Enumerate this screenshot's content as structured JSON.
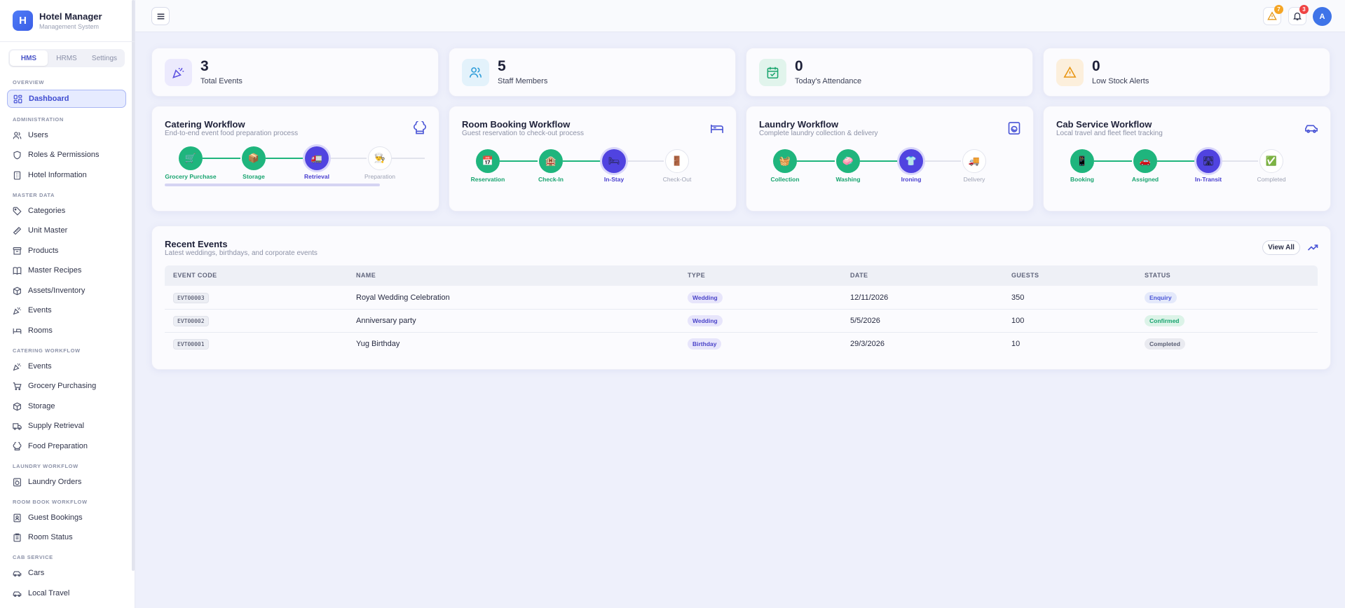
{
  "app": {
    "logo_letter": "H",
    "title": "Hotel Manager",
    "subtitle": "Management System"
  },
  "sidebar": {
    "tabs": [
      {
        "label": "HMS",
        "active": true
      },
      {
        "label": "HRMS",
        "active": false
      },
      {
        "label": "Settings",
        "active": false
      }
    ],
    "sections": {
      "overview": "OVERVIEW",
      "administration": "ADMINISTRATION",
      "master_data": "MASTER DATA",
      "catering": "CATERING WORKFLOW",
      "laundry": "LAUNDRY WORKFLOW",
      "room_book": "ROOM BOOK WORKFLOW",
      "cab": "CAB SERVICE"
    },
    "items": {
      "dashboard": "Dashboard",
      "users": "Users",
      "roles": "Roles & Permissions",
      "hotel_info": "Hotel Information",
      "categories": "Categories",
      "unit_master": "Unit Master",
      "products": "Products",
      "master_recipes": "Master Recipes",
      "assets": "Assets/Inventory",
      "events": "Events",
      "rooms": "Rooms",
      "catering_events": "Events",
      "grocery": "Grocery Purchasing",
      "storage": "Storage",
      "supply_retrieval": "Supply Retrieval",
      "food_prep": "Food Preparation",
      "laundry_orders": "Laundry Orders",
      "guest_bookings": "Guest Bookings",
      "room_status": "Room Status",
      "cars": "Cars",
      "local_travel": "Local Travel"
    }
  },
  "topbar": {
    "alerts_count": "7",
    "notifications_count": "3",
    "avatar_letter": "A",
    "colors": {
      "alert_badge": "#f5a524",
      "notif_badge": "#ef4444",
      "avatar": "#3f74e8"
    }
  },
  "stats": [
    {
      "value": "3",
      "label": "Total Events",
      "icon": "party-popper-icon"
    },
    {
      "value": "5",
      "label": "Staff Members",
      "icon": "users-icon"
    },
    {
      "value": "0",
      "label": "Today's Attendance",
      "icon": "calendar-check-icon"
    },
    {
      "value": "0",
      "label": "Low Stock Alerts",
      "icon": "warning-icon"
    }
  ],
  "workflows": {
    "catering": {
      "title": "Catering Workflow",
      "subtitle": "End-to-end event food preparation process",
      "icon": "chef-hat-icon",
      "steps": [
        {
          "label": "Grocery Purchase",
          "emoji": "🛒",
          "state": "done"
        },
        {
          "label": "Storage",
          "emoji": "📦",
          "state": "done"
        },
        {
          "label": "Retrieval",
          "emoji": "🚛",
          "state": "current"
        },
        {
          "label": "Preparation",
          "emoji": "👨‍🍳",
          "state": "todo"
        }
      ],
      "progress": 0.75
    },
    "room": {
      "title": "Room Booking Workflow",
      "subtitle": "Guest reservation to check-out process",
      "icon": "bed-icon",
      "steps": [
        {
          "label": "Reservation",
          "emoji": "📅",
          "state": "done"
        },
        {
          "label": "Check-In",
          "emoji": "🏨",
          "state": "done"
        },
        {
          "label": "In-Stay",
          "emoji": "🛏",
          "state": "current"
        },
        {
          "label": "Check-Out",
          "emoji": "🚪",
          "state": "todo"
        }
      ]
    },
    "laundry": {
      "title": "Laundry Workflow",
      "subtitle": "Complete laundry collection & delivery",
      "icon": "washing-machine-icon",
      "steps": [
        {
          "label": "Collection",
          "emoji": "🧺",
          "state": "done"
        },
        {
          "label": "Washing",
          "emoji": "🧼",
          "state": "done"
        },
        {
          "label": "Ironing",
          "emoji": "👕",
          "state": "current"
        },
        {
          "label": "Delivery",
          "emoji": "🚚",
          "state": "todo"
        }
      ]
    },
    "cab": {
      "title": "Cab Service Workflow",
      "subtitle": "Local travel and fleet fleet tracking",
      "icon": "car-icon",
      "steps": [
        {
          "label": "Booking",
          "emoji": "📱",
          "state": "done"
        },
        {
          "label": "Assigned",
          "emoji": "🚗",
          "state": "done"
        },
        {
          "label": "In-Transit",
          "emoji": "🛣",
          "state": "current"
        },
        {
          "label": "Completed",
          "emoji": "✅",
          "state": "todo"
        }
      ]
    }
  },
  "events": {
    "title": "Recent Events",
    "subtitle": "Latest weddings, birthdays, and corporate events",
    "view_all": "View All",
    "columns": [
      "EVENT CODE",
      "NAME",
      "TYPE",
      "DATE",
      "GUESTS",
      "STATUS"
    ],
    "rows": [
      {
        "code": "EVT00003",
        "name": "Royal Wedding Celebration",
        "type": "Wedding",
        "date": "12/11/2026",
        "guests": "350",
        "status": "Enquiry"
      },
      {
        "code": "EVT00002",
        "name": "Anniversary party",
        "type": "Wedding",
        "date": "5/5/2026",
        "guests": "100",
        "status": "Confirmed"
      },
      {
        "code": "EVT00001",
        "name": "Yug Birthday",
        "type": "Birthday",
        "date": "29/3/2026",
        "guests": "10",
        "status": "Completed"
      }
    ],
    "status_colors": {
      "Enquiry": "#4a55d6",
      "Confirmed": "#18a46f",
      "Completed": "#5a5f74"
    }
  }
}
